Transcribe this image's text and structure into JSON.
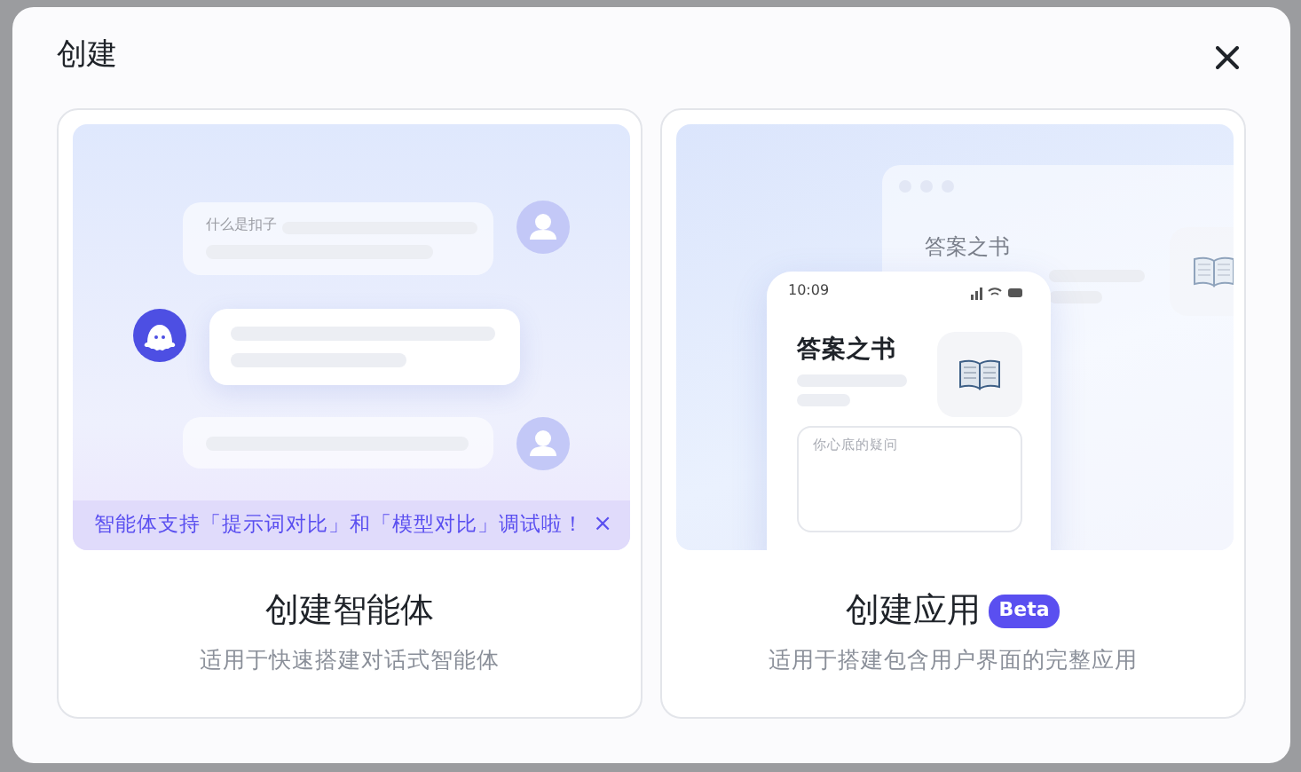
{
  "dialog": {
    "title": "创建"
  },
  "options": [
    {
      "kind": "agent",
      "title": "创建智能体",
      "description": "适用于快速搭建对话式智能体",
      "preview": {
        "question": "什么是扣子"
      },
      "notice": {
        "text": "智能体支持「提示词对比」和「模型对比」调试啦！",
        "dismiss": "×"
      }
    },
    {
      "kind": "app",
      "title": "创建应用",
      "badge": "Beta",
      "description": "适用于搭建包含用户界面的完整应用",
      "preview": {
        "window_title": "答案之书",
        "phone_time": "10:09",
        "app_name": "答案之书",
        "input_placeholder": "你心底的疑问"
      }
    }
  ]
}
